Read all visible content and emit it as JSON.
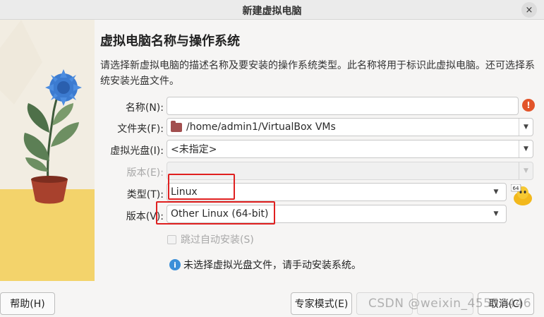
{
  "window": {
    "title": "新建虚拟电脑",
    "close_icon": "×"
  },
  "page": {
    "heading": "虚拟电脑名称与操作系统",
    "description": "请选择新虚拟电脑的描述名称及要安装的操作系统类型。此名称将用于标识此虚拟电脑。还可选择系统安装光盘文件。"
  },
  "form": {
    "name_label": "名称(N):",
    "name_value": "",
    "folder_label": "文件夹(F):",
    "folder_value": "/home/admin1/VirtualBox VMs",
    "iso_label": "虚拟光盘(I):",
    "iso_value": "<未指定>",
    "edition_label": "版本(E):",
    "edition_value": "",
    "type_label": "类型(T):",
    "type_value": "Linux",
    "version_label": "版本(V):",
    "version_value": "Other Linux (64-bit)",
    "os_icon_badge": "64",
    "unattended_label": "跳过自动安装(S)",
    "info_text": "未选择虚拟光盘文件，请手动安装系统。"
  },
  "buttons": {
    "help": "帮助(H)",
    "expert": "专家模式(E)",
    "back": "",
    "next": "",
    "cancel": "取消(C)"
  },
  "watermark": "CSDN @weixin_45556446",
  "colors": {
    "annotation_red": "#e02020",
    "warning": "#e2542a",
    "info": "#3c8fd8",
    "folder": "#a24f4f"
  }
}
